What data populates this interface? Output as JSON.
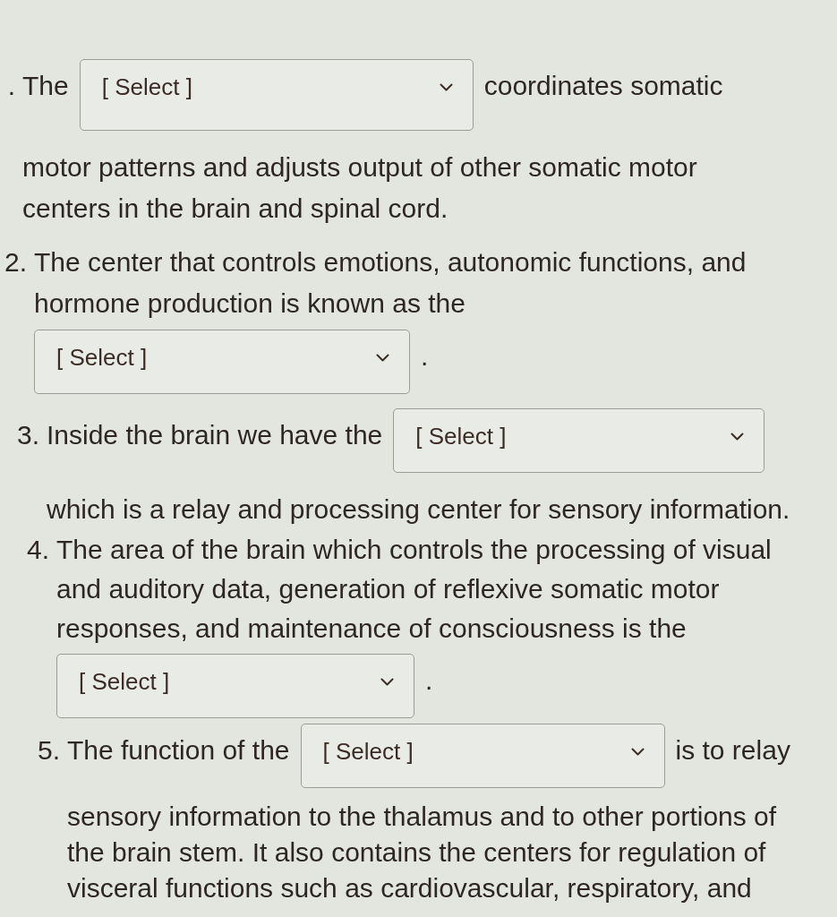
{
  "questions": [
    {
      "number": ".",
      "lead": "The",
      "dropdown": {
        "value": "[ Select ]"
      },
      "trail": "coordinates somatic",
      "continuation": "motor patterns and adjusts output of other somatic motor centers in the brain and spinal cord."
    },
    {
      "number": "2.",
      "lead": "The center that controls emotions, autonomic functions, and hormone production is known as the",
      "dropdown": {
        "value": "[ Select ]"
      },
      "trail": "."
    },
    {
      "number": "3.",
      "lead": "Inside the brain we have the",
      "dropdown": {
        "value": "[ Select ]"
      },
      "continuation": "which is a relay and processing center for sensory information."
    },
    {
      "number": "4.",
      "lead": "The area of the brain which controls the processing of visual and auditory data, generation of reflexive somatic motor responses, and maintenance of consciousness is the",
      "dropdown": {
        "value": "[ Select ]"
      },
      "trail": "."
    },
    {
      "number": "5.",
      "lead": "The function of the",
      "dropdown": {
        "value": "[ Select ]"
      },
      "trail": "is to relay",
      "continuation": "sensory information to the thalamus and to other portions of the brain stem. It also contains the centers for regulation of visceral functions such as cardiovascular, respiratory, and"
    }
  ]
}
